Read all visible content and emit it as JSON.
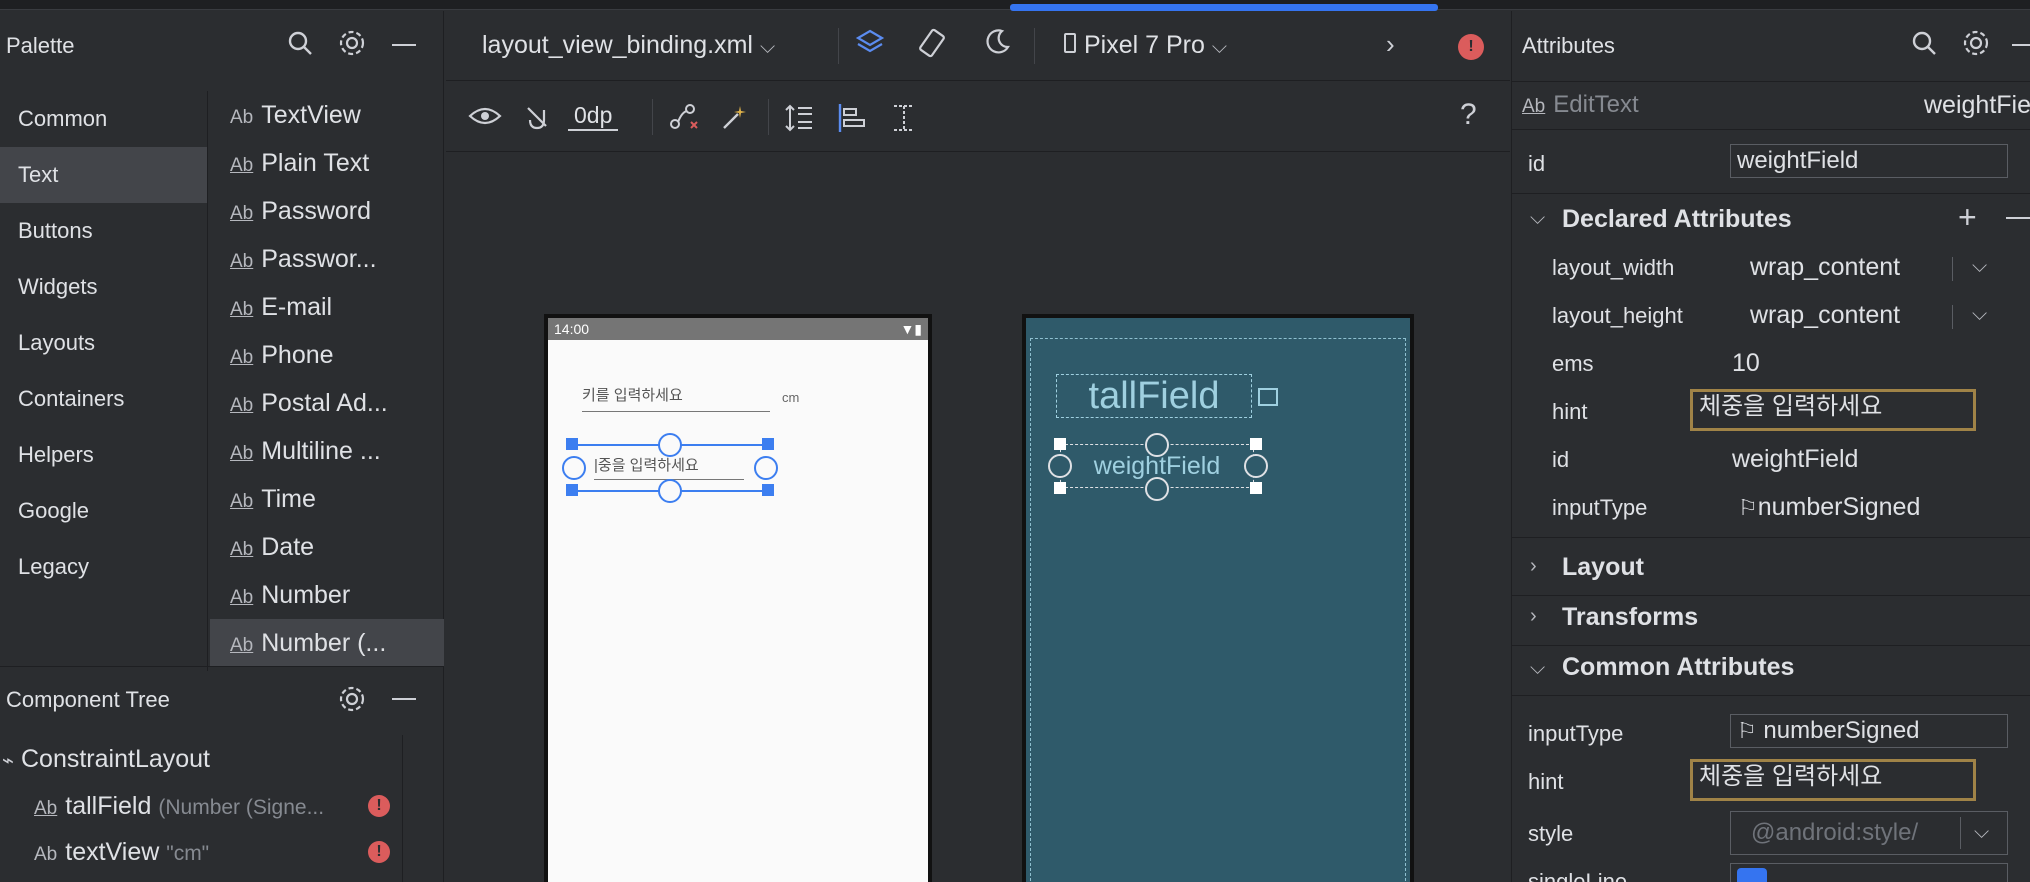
{
  "palette": {
    "title": "Palette",
    "categories": [
      "Common",
      "Text",
      "Buttons",
      "Widgets",
      "Layouts",
      "Containers",
      "Helpers",
      "Google",
      "Legacy"
    ],
    "selected_category": "Text",
    "widgets": [
      "TextView",
      "Plain Text",
      "Password",
      "Passwor...",
      "E-mail",
      "Phone",
      "Postal Ad...",
      "Multiline ...",
      "Time",
      "Date",
      "Number",
      "Number (..."
    ],
    "widget_prefix": "Ab"
  },
  "component_tree": {
    "title": "Component Tree",
    "root": "ConstraintLayout",
    "items": [
      {
        "name": "tallField",
        "detail": "(Number (Signe...",
        "error": true
      },
      {
        "name": "textView",
        "detail": "\"cm\"",
        "error": true
      }
    ]
  },
  "editor": {
    "file_name": "layout_view_binding.xml",
    "device": "Pixel 7 Pro",
    "margin_value": "0dp",
    "help": "?"
  },
  "design": {
    "status_time": "14:00",
    "tall_hint": "키를 입력하세요",
    "unit": "cm",
    "weight_hint": "|중을 입력하세요",
    "blueprint_tall": "tallField",
    "blueprint_weight": "weightField"
  },
  "attributes": {
    "title": "Attributes",
    "widget_type": "EditText",
    "widget_id_display": "weightFie",
    "id_label": "id",
    "id_value": "weightField",
    "declared_title": "Declared Attributes",
    "declared": [
      {
        "label": "layout_width",
        "value": "wrap_content"
      },
      {
        "label": "layout_height",
        "value": "wrap_content"
      },
      {
        "label": "ems",
        "value": "10"
      },
      {
        "label": "hint",
        "value": "체중을 입력하세요"
      },
      {
        "label": "id",
        "value": "weightField"
      },
      {
        "label": "inputType",
        "value": "numberSigned"
      }
    ],
    "layout_title": "Layout",
    "transforms_title": "Transforms",
    "common_title": "Common Attributes",
    "common": [
      {
        "label": "inputType",
        "value": "numberSigned"
      },
      {
        "label": "hint",
        "value": "체중을 입력하세요"
      },
      {
        "label": "style",
        "value": "@android:style/"
      },
      {
        "label": "singleLine",
        "value": ""
      }
    ]
  },
  "colors": {
    "accent": "#3574f0",
    "error": "#db5c5c",
    "blueprint": "#2f5a6a",
    "focus_border": "#a08347"
  }
}
